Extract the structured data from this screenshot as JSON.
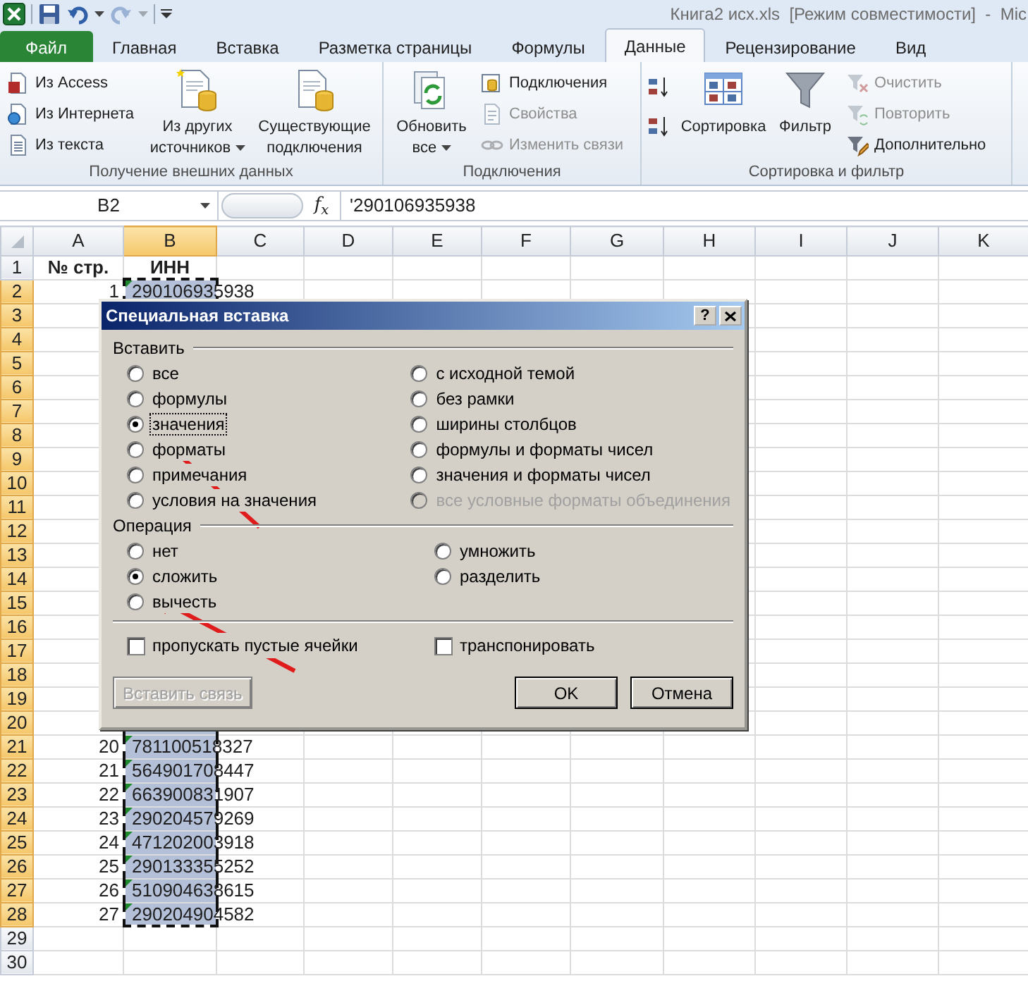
{
  "window": {
    "title": "Книга2 исх.xls  [Режим совместимости]  -  Mic"
  },
  "quick_access": [
    {
      "kind": "save",
      "disabled": false
    },
    {
      "kind": "undo",
      "disabled": false
    },
    {
      "kind": "redo",
      "disabled": true
    }
  ],
  "tabs": [
    {
      "label": "Файл",
      "kind": "file",
      "selected": false
    },
    {
      "label": "Главная",
      "kind": "tab",
      "selected": false
    },
    {
      "label": "Вставка",
      "kind": "tab",
      "selected": false
    },
    {
      "label": "Разметка страницы",
      "kind": "tab",
      "selected": false
    },
    {
      "label": "Формулы",
      "kind": "tab",
      "selected": false
    },
    {
      "label": "Данные",
      "kind": "tab",
      "selected": true
    },
    {
      "label": "Рецензирование",
      "kind": "tab",
      "selected": false
    },
    {
      "label": "Вид",
      "kind": "tab",
      "selected": false
    }
  ],
  "ribbon": [
    {
      "label": "Получение внешних данных",
      "columns": [
        [
          {
            "kind": "small",
            "label": "Из Access",
            "disabled": false
          },
          {
            "kind": "small",
            "label": "Из Интернета",
            "disabled": false
          },
          {
            "kind": "small",
            "label": "Из текста",
            "disabled": false
          }
        ],
        [
          {
            "kind": "large",
            "label": "Из других источников",
            "menu": true
          }
        ],
        [
          {
            "kind": "large",
            "label": "Существующие подключения",
            "menu": false
          }
        ]
      ]
    },
    {
      "label": "Подключения",
      "columns": [
        [
          {
            "kind": "large",
            "label": "Обновить все",
            "menu": true
          }
        ],
        [
          {
            "kind": "small",
            "label": "Подключения",
            "disabled": false
          },
          {
            "kind": "small",
            "label": "Свойства",
            "disabled": true
          },
          {
            "kind": "small",
            "label": "Изменить связи",
            "disabled": true
          }
        ]
      ]
    },
    {
      "label": "Сортировка и фильтр",
      "columns": [
        [
          {
            "kind": "icon",
            "disabled": false
          },
          {
            "kind": "icon",
            "disabled": false
          }
        ],
        [
          {
            "kind": "large",
            "label": "Сортировка",
            "menu": false
          }
        ],
        [
          {
            "kind": "large",
            "label": "Фильтр",
            "menu": false
          }
        ],
        [
          {
            "kind": "small",
            "label": "Очистить",
            "disabled": true
          },
          {
            "kind": "small",
            "label": "Повторить",
            "disabled": true
          },
          {
            "kind": "small",
            "label": "Дополнительно",
            "disabled": false
          }
        ]
      ]
    }
  ],
  "formula_bar": {
    "name_box": "B2",
    "fx_label": "f$_{x}$",
    "formula": "'290106935938"
  },
  "sheet": {
    "columns": [
      {
        "label": "A",
        "selected": false
      },
      {
        "label": "B",
        "selected": true
      },
      {
        "label": "C",
        "selected": false
      },
      {
        "label": "D",
        "selected": false
      },
      {
        "label": "E",
        "selected": false
      },
      {
        "label": "F",
        "selected": false
      },
      {
        "label": "G",
        "selected": false
      },
      {
        "label": "H",
        "selected": false
      },
      {
        "label": "I",
        "selected": false
      },
      {
        "label": "J",
        "selected": false
      },
      {
        "label": "K",
        "selected": false
      }
    ],
    "rows": [
      {
        "header": "1",
        "kind": "heading",
        "selected": false,
        "flagged": false,
        "cells": [
          "№ стр.",
          "ИНН"
        ]
      },
      {
        "header": "2",
        "kind": "data",
        "selected": true,
        "flagged": true,
        "cells": [
          "1",
          "290106935938"
        ]
      },
      {
        "header": "3",
        "kind": "data",
        "selected": true,
        "flagged": false
      },
      {
        "header": "4",
        "kind": "data",
        "selected": true,
        "flagged": false
      },
      {
        "header": "5",
        "kind": "data",
        "selected": true,
        "flagged": false
      },
      {
        "header": "6",
        "kind": "data",
        "selected": true,
        "flagged": false
      },
      {
        "header": "7",
        "kind": "data",
        "selected": true,
        "flagged": false
      },
      {
        "header": "8",
        "kind": "data",
        "selected": true,
        "flagged": false
      },
      {
        "header": "9",
        "kind": "data",
        "selected": true,
        "flagged": false
      },
      {
        "header": "10",
        "kind": "data",
        "selected": true,
        "flagged": false
      },
      {
        "header": "11",
        "kind": "data",
        "selected": true,
        "flagged": false
      },
      {
        "header": "12",
        "kind": "data",
        "selected": true,
        "flagged": false
      },
      {
        "header": "13",
        "kind": "data",
        "selected": true,
        "flagged": false
      },
      {
        "header": "14",
        "kind": "data",
        "selected": true,
        "flagged": false
      },
      {
        "header": "15",
        "kind": "data",
        "selected": true,
        "flagged": false
      },
      {
        "header": "16",
        "kind": "data",
        "selected": true,
        "flagged": false
      },
      {
        "header": "17",
        "kind": "data",
        "selected": true,
        "flagged": false
      },
      {
        "header": "18",
        "kind": "data",
        "selected": true,
        "flagged": false
      },
      {
        "header": "19",
        "kind": "data",
        "selected": true,
        "flagged": false
      },
      {
        "header": "20",
        "kind": "data",
        "selected": true,
        "flagged": false
      },
      {
        "header": "21",
        "kind": "data",
        "selected": true,
        "flagged": true,
        "cells": [
          "20",
          "781100518327"
        ]
      },
      {
        "header": "22",
        "kind": "data",
        "selected": true,
        "flagged": true,
        "cells": [
          "21",
          "564901708447"
        ]
      },
      {
        "header": "23",
        "kind": "data",
        "selected": true,
        "flagged": true,
        "cells": [
          "22",
          "663900831907"
        ]
      },
      {
        "header": "24",
        "kind": "data",
        "selected": true,
        "flagged": true,
        "cells": [
          "23",
          "290204579269"
        ]
      },
      {
        "header": "25",
        "kind": "data",
        "selected": true,
        "flagged": true,
        "cells": [
          "24",
          "471202003918"
        ]
      },
      {
        "header": "26",
        "kind": "data",
        "selected": true,
        "flagged": true,
        "cells": [
          "25",
          "290133355252"
        ]
      },
      {
        "header": "27",
        "kind": "data",
        "selected": true,
        "flagged": true,
        "cells": [
          "26",
          "510904638615"
        ]
      },
      {
        "header": "28",
        "kind": "data",
        "selected": true,
        "flagged": true,
        "cells": [
          "27",
          "290204904582"
        ]
      },
      {
        "header": "29",
        "kind": "data",
        "selected": false,
        "flagged": false
      },
      {
        "header": "30",
        "kind": "data",
        "selected": false,
        "flagged": false
      }
    ]
  },
  "dialog": {
    "title": "Специальная вставка",
    "help_label": "?",
    "paste": {
      "label": "Вставить",
      "options": [
        [
          {
            "label": "все",
            "selected": false,
            "focused": false,
            "disabled": false
          },
          {
            "label": "формулы",
            "selected": false,
            "focused": false,
            "disabled": false
          },
          {
            "label": "значения",
            "selected": true,
            "focused": true,
            "disabled": false
          },
          {
            "label": "форматы",
            "selected": false,
            "focused": false,
            "disabled": false
          },
          {
            "label": "примечания",
            "selected": false,
            "focused": false,
            "disabled": false
          },
          {
            "label": "условия на значения",
            "selected": false,
            "focused": false,
            "disabled": false
          }
        ],
        [
          {
            "label": "с исходной темой",
            "selected": false,
            "focused": false,
            "disabled": false
          },
          {
            "label": "без рамки",
            "selected": false,
            "focused": false,
            "disabled": false
          },
          {
            "label": "ширины столбцов",
            "selected": false,
            "focused": false,
            "disabled": false
          },
          {
            "label": "формулы и форматы чисел",
            "selected": false,
            "focused": false,
            "disabled": false
          },
          {
            "label": "значения и форматы чисел",
            "selected": false,
            "focused": false,
            "disabled": false
          },
          {
            "label": "все условные форматы объединения",
            "selected": false,
            "focused": false,
            "disabled": true
          }
        ]
      ]
    },
    "operation": {
      "label": "Операция",
      "options": [
        [
          {
            "label": "нет",
            "selected": false,
            "focused": false,
            "disabled": false
          },
          {
            "label": "сложить",
            "selected": true,
            "focused": false,
            "disabled": false
          },
          {
            "label": "вычесть",
            "selected": false,
            "focused": false,
            "disabled": false
          }
        ],
        [
          {
            "label": "умножить",
            "selected": false,
            "focused": false,
            "disabled": false
          },
          {
            "label": "разделить",
            "selected": false,
            "focused": false,
            "disabled": false
          }
        ]
      ]
    },
    "checkboxes": [
      {
        "label": "пропускать пустые ячейки",
        "checked": false
      },
      {
        "label": "транспонировать",
        "checked": false
      }
    ],
    "buttons": [
      {
        "label": "Вставить связь",
        "disabled": true
      },
      {
        "label": "OK",
        "disabled": false
      },
      {
        "label": "Отмена",
        "disabled": false
      }
    ]
  }
}
